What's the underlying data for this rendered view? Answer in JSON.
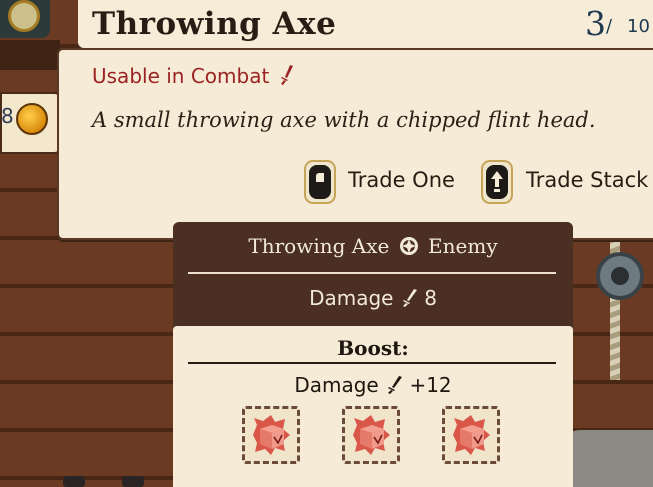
{
  "item": {
    "name": "Throwing Axe",
    "count": "3",
    "max": "10",
    "count_slash": "/",
    "usable": "Usable in Combat",
    "description": "A small throwing axe with a chipped flint head."
  },
  "actions": {
    "trade_one": "Trade One",
    "trade_stack": "Trade Stack"
  },
  "combat": {
    "name": "Throwing Axe",
    "target": "Enemy",
    "damage_label": "Damage",
    "damage_value": "8",
    "boost_title": "Boost:",
    "boost_damage_label": "Damage",
    "boost_damage_value": "+12",
    "boost_dice": [
      "damage-die",
      "damage-die",
      "damage-die"
    ]
  },
  "hud": {
    "coins": "8"
  },
  "colors": {
    "usable_red": "#9b2423",
    "panel_dark": "#4a2f22",
    "parchment": "#f5ebd6",
    "count_blue": "#1f3950",
    "die_red": "#e2685a"
  }
}
